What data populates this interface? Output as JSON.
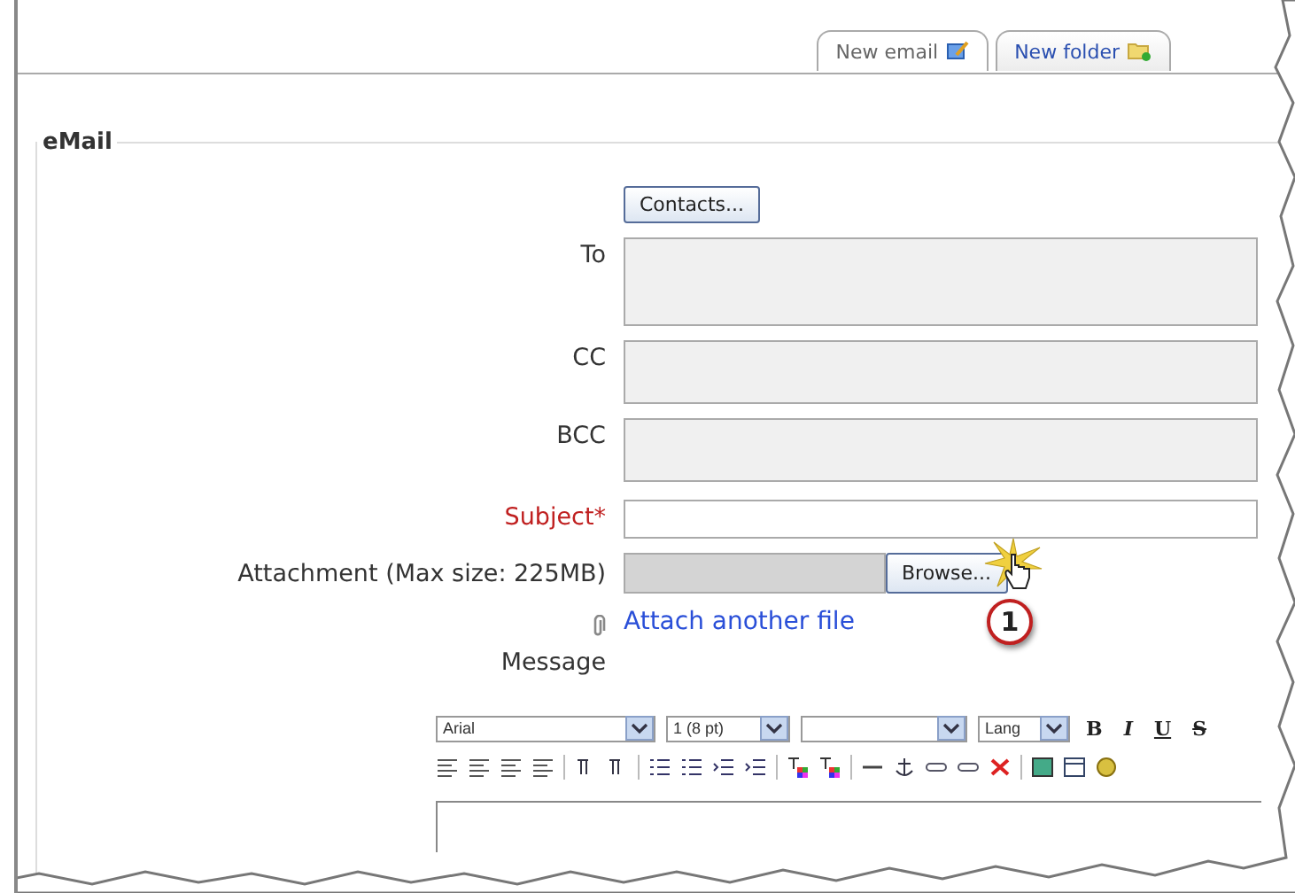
{
  "tabs": [
    {
      "label": "New email",
      "selected": true
    },
    {
      "label": "New folder",
      "selected": false
    }
  ],
  "form": {
    "legend": "eMail",
    "contacts_button": "Contacts...",
    "fields": [
      {
        "label": "To",
        "kind": "textarea",
        "required": false
      },
      {
        "label": "CC",
        "kind": "textarea",
        "required": false
      },
      {
        "label": "BCC",
        "kind": "textarea",
        "required": false
      },
      {
        "label": "Subject*",
        "kind": "input",
        "required": true
      },
      {
        "label": "Attachment (Max size: 225MB)",
        "kind": "file",
        "button": "Browse..."
      }
    ],
    "attach_link": "Attach another file",
    "message_label": "Message"
  },
  "editor": {
    "selects": [
      {
        "kind": "text",
        "value": "Arial"
      },
      {
        "kind": "text",
        "value": "1 (8 pt)"
      },
      {
        "kind": "blank"
      },
      {
        "kind": "text",
        "value": "Lang"
      }
    ],
    "format_buttons": [
      "B",
      "I",
      "U",
      "S"
    ]
  },
  "callout": {
    "number": "1"
  }
}
